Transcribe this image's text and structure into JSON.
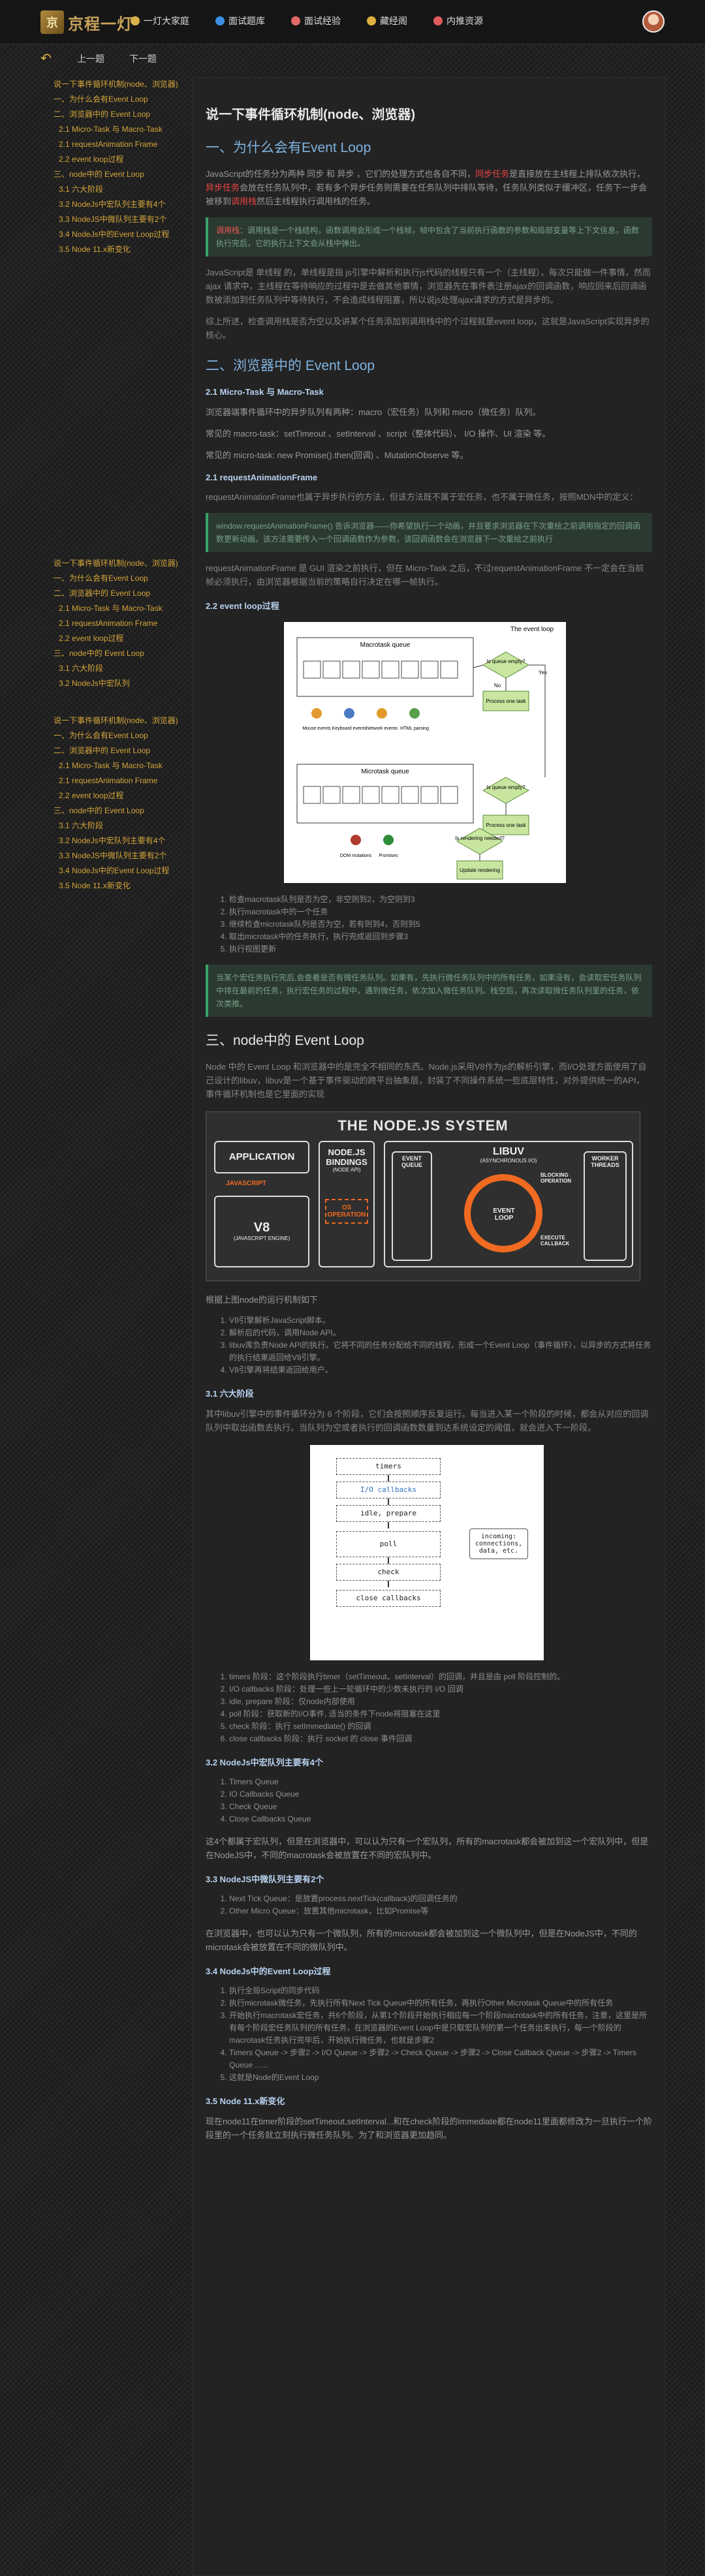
{
  "header": {
    "logo_mark": "京",
    "logo_text": "京程一灯",
    "nav": [
      {
        "label": "一灯大家庭",
        "color": "#d8b14a"
      },
      {
        "label": "面试题库",
        "color": "#3c8fe0"
      },
      {
        "label": "面试经验",
        "color": "#e06a6a"
      },
      {
        "label": "藏经阁",
        "color": "#e0b040"
      },
      {
        "label": "内推资源",
        "color": "#e05a5a"
      }
    ]
  },
  "subbar": {
    "prev": "上一题",
    "next": "下一题"
  },
  "toc": {
    "block1": [
      {
        "label": "说一下事件循环机制(node、浏览器)",
        "level": 1
      },
      {
        "label": "一、为什么会有Event Loop",
        "level": 1
      },
      {
        "label": "二、浏览器中的 Event Loop",
        "level": 1
      },
      {
        "label": "2.1 Micro-Task 与 Macro-Task",
        "level": 2
      },
      {
        "label": "2.1 requestAnimation Frame",
        "level": 2
      },
      {
        "label": "2.2 event loop过程",
        "level": 2
      },
      {
        "label": "三、node中的 Event Loop",
        "level": 1
      },
      {
        "label": "3.1 六大阶段",
        "level": 2
      },
      {
        "label": "3.2 NodeJs中宏队列主要有4个",
        "level": 2
      },
      {
        "label": "3.3 NodeJS中微队列主要有2个",
        "level": 2
      },
      {
        "label": "3.4 NodeJs中的Event Loop过程",
        "level": 2
      },
      {
        "label": "3.5 Node 11.x新变化",
        "level": 2
      }
    ],
    "block2": [
      {
        "label": "说一下事件循环机制(node、浏览器)",
        "level": 1
      },
      {
        "label": "一、为什么会有Event Loop",
        "level": 1
      },
      {
        "label": "二、浏览器中的 Event Loop",
        "level": 1
      },
      {
        "label": "2.1 Micro-Task 与 Macro-Task",
        "level": 2
      },
      {
        "label": "2.1 requestAnimation Frame",
        "level": 2
      },
      {
        "label": "2.2 event loop过程",
        "level": 2
      },
      {
        "label": "三、node中的 Event Loop",
        "level": 1
      },
      {
        "label": "3.1 六大阶段",
        "level": 2
      },
      {
        "label": "3.2 NodeJs中宏队列",
        "level": 2
      }
    ],
    "block3": [
      {
        "label": "说一下事件循环机制(node、浏览器)",
        "level": 1
      },
      {
        "label": "一、为什么会有Event Loop",
        "level": 1
      },
      {
        "label": "二、浏览器中的 Event Loop",
        "level": 1
      },
      {
        "label": "2.1 Micro-Task 与 Macro-Task",
        "level": 2
      },
      {
        "label": "2.1 requestAnimation Frame",
        "level": 2
      },
      {
        "label": "2.2 event loop过程",
        "level": 2
      },
      {
        "label": "三、node中的 Event Loop",
        "level": 1
      },
      {
        "label": "3.1 六大阶段",
        "level": 2
      },
      {
        "label": "3.2 NodeJs中宏队列主要有4个",
        "level": 2
      },
      {
        "label": "3.3 NodeJS中微队列主要有2个",
        "level": 2
      },
      {
        "label": "3.4 NodeJs中的Event Loop过程",
        "level": 2
      },
      {
        "label": "3.5 Node 11.x新变化",
        "level": 2
      }
    ]
  },
  "article": {
    "title": "说一下事件循环机制(node、浏览器)",
    "h2_1": "一、为什么会有Event Loop",
    "p1a": "JavaScript的任务分为两种 同步 和 异步 ，它们的处理方式也各自不同，",
    "p1_red1": "同步任务",
    "p1b": "是直接放在主线程上排队依次执行，",
    "p1_red2": "异步任务",
    "p1c": "会放在任务队列中，若有多个异步任务则需要在任务队列中排队等待，任务队列类似于缓冲区，任务下一步会被移到",
    "p1_red3": "调用栈",
    "p1d": "然后主线程执行调用栈的任务。",
    "note1_head": "调用栈",
    "note1": "：调用栈是一个栈结构，函数调用会形成一个栈帧，帧中包含了当前执行函数的参数和局部变量等上下文信息，函数执行完后，它的执行上下文会从栈中弹出。",
    "p2": "JavaScript是 单线程 的，单线程是指 js引擎中解析和执行js代码的线程只有一个（主线程），每次只能做一件事情，然而 ajax 请求中，主线程在等待响应的过程中是去做其他事情，浏览器先在事件表注册ajax的回调函数，响应回来后回调函数被添加到任务队列中等待执行，不会造成线程阻塞，所以说js处理ajax请求的方式是异步的。",
    "p3": "综上所述，检查调用栈是否为空以及讲某个任务添加到调用栈中的个过程就是event loop，这就是JavaScript实现异步的核心。",
    "h2_2": "二、浏览器中的 Event Loop",
    "h3_21": "2.1 Micro-Task 与 Macro-Task",
    "p4": "浏览器端事件循环中的异步队列有两种：macro（宏任务）队列和 micro（微任务）队列。",
    "p5": "常见的 macro-task：setTimeout 、setInterval 、script（整体代码）、 I/O 操作、UI 渲染 等。",
    "p6": "常见的 micro-task: new Promise().then(回调) 、MutationObserve 等。",
    "h3_22": "2.1 requestAnimationFrame",
    "p7": "requestAnimationFrame也属于异步执行的方法，但该方法既不属于宏任务，也不属于微任务，按照MDN中的定义：",
    "note2": "window.requestAnimationFrame() 告诉浏览器——你希望执行一个动画，并且要求浏览器在下次重绘之前调用指定的回调函数更新动画。该方法需要传入一个回调函数作为参数，该回调函数会在浏览器下一次重绘之前执行",
    "p8": "requestAnimationFrame 是 GUI 渲染之前执行，但在 Micro-Task 之后，不过requestAnimationFrame 不一定会在当前帧必须执行，由浏览器根据当前的策略自行决定在哪一帧执行。",
    "h3_23": "2.2 event loop过程",
    "fig1": {
      "title": "The event loop",
      "macro": "Macrotask queue",
      "micro": "Microtask queue",
      "q1": "Is queue empty?",
      "q2": "Is queue empty?",
      "q3": "Is rendering needed?",
      "p1": "Process one task",
      "p2": "Process one task",
      "upd": "Update rendering",
      "yes": "Yes",
      "no": "No",
      "src1": [
        "Mouse events",
        "Keyboard events",
        "Network events",
        "HTML parsing"
      ],
      "src2": [
        "DOM mutations",
        "Promises"
      ]
    },
    "steps1": [
      "检查macrotask队列是否为空，非空则到2，为空则到3",
      "执行macrotask中的一个任务",
      "继续检查microtask队列是否为空，若有则到4，否则到5",
      "取出microtask中的任务执行，执行完成返回到步骤3",
      "执行视图更新"
    ],
    "note3": "当某个宏任务执行完后,会查看是否有微任务队列。如果有，先执行微任务队列中的所有任务，如果没有，会读取宏任务队列中排在最前的任务，执行宏任务的过程中，遇到微任务，依次加入微任务队列。栈空后，再次读取微任务队列里的任务，依次类推。",
    "h2_3": "三、node中的 Event Loop",
    "p9": "Node 中的 Event Loop 和浏览器中的是完全不相同的东西。Node.js采用V8作为js的解析引擎，而I/O处理方面使用了自己设计的libuv，libuv是一个基于事件驱动的跨平台抽象层，封装了不同操作系统一些底层特性，对外提供统一的API，事件循环机制也是它里面的实现",
    "fig2": {
      "title": "THE NODE.JS SYSTEM",
      "app": "APPLICATION",
      "js": "JAVASCRIPT",
      "v8": "V8",
      "v8sub": "(JAVASCRIPT ENGINE)",
      "bind": "NODE.JS BINDINGS",
      "bindsub": "(NODE API)",
      "os": "OS OPERATION",
      "libuv": "LIBUV",
      "libuvsub": "(ASYNCHRONOUS I/O)",
      "eq": "EVENT QUEUE",
      "loop": "EVENT LOOP",
      "block": "BLOCKING OPERATION",
      "worker": "WORKER THREADS",
      "exec": "EXECUTE CALLBACK"
    },
    "p10": "根据上图node的运行机制如下",
    "steps2": [
      "V8引擎解析JavaScript脚本。",
      "解析后的代码，调用Node API。",
      "libuv库负责Node API的执行。它将不同的任务分配给不同的线程，形成一个Event Loop（事件循环），以异步的方式将任务的执行结果返回给V8引擎。",
      "V8引擎再将结果返回给用户。"
    ],
    "h3_31": "3.1 六大阶段",
    "p11": "其中libuv引擎中的事件循环分为 6 个阶段，它们会按照顺序反复运行。每当进入某一个阶段的时候，都会从对应的回调队列中取出函数去执行。当队列为空或者执行的回调函数数量到达系统设定的阈值，就会进入下一阶段。",
    "fig3": {
      "phases": [
        "timers",
        "I/O callbacks",
        "idle, prepare",
        "poll",
        "check",
        "close callbacks"
      ],
      "incoming": "incoming: connections, data, etc."
    },
    "steps3": [
      "timers 阶段：这个阶段执行timer（setTimeout、setInterval）的回调，并且是由 poll 阶段控制的。",
      "I/O callbacks 阶段：处理一些上一轮循环中的少数未执行的 I/O 回调",
      "idle, prepare 阶段：仅node内部使用",
      "poll 阶段：获取新的I/O事件, 适当的条件下node将阻塞在这里",
      "check 阶段：执行 setImmediate() 的回调",
      "close callbacks 阶段：执行 socket 的 close 事件回调"
    ],
    "h3_32": "3.2 NodeJs中宏队列主要有4个",
    "steps4": [
      "Timers Queue",
      "IO Callbacks Queue",
      "Check Queue",
      "Close Callbacks Queue"
    ],
    "p12": "这4个都属于宏队列，但是在浏览器中，可以认为只有一个宏队列，所有的macrotask都会被加到这一个宏队列中，但是在NodeJS中，不同的macrotask会被放置在不同的宏队列中。",
    "h3_33": "3.3 NodeJS中微队列主要有2个",
    "steps5": [
      "Next Tick Queue：是放置process.nextTick(callback)的回调任务的",
      "Other Micro Queue：放置其他microtask，比如Promise等"
    ],
    "p13": "在浏览器中，也可以认为只有一个微队列，所有的microtask都会被加到这一个微队列中，但是在NodeJS中，不同的microtask会被放置在不同的微队列中。",
    "h3_34": "3.4 NodeJs中的Event Loop过程",
    "steps6": [
      "执行全局Script的同步代码",
      "执行microtask微任务，先执行所有Next Tick Queue中的所有任务，再执行Other Microtask Queue中的所有任务",
      "开始执行macrotask宏任务，共6个阶段，从第1个阶段开始执行相应每一个阶段macrotask中的所有任务，注意，这里是所有每个阶段宏任务队列的所有任务，在浏览器的Event Loop中是只取宏队列的第一个任务出来执行，每一个阶段的macrotask任务执行完毕后，开始执行微任务，也就是步骤2",
      "Timers Queue -> 步骤2 -> I/O Queue -> 步骤2 -> Check Queue -> 步骤2 -> Close Callback Queue -> 步骤2 -> Timers Queue ......",
      "这就是Node的Event Loop"
    ],
    "h3_35": "3.5 Node 11.x新变化",
    "p14": "现在node11在timer阶段的setTimeout,setInterval...和在check阶段的immediate都在node11里面都修改为一旦执行一个阶段里的一个任务就立刻执行微任务队列。为了和浏览器更加趋同。"
  }
}
